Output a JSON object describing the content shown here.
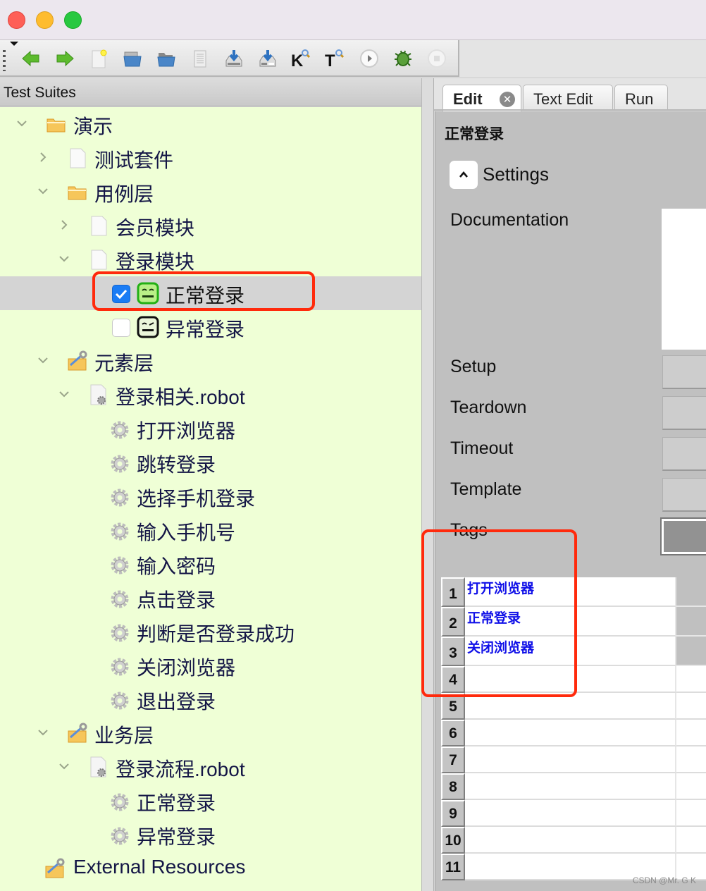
{
  "window": {
    "controls": [
      "close",
      "minimize",
      "zoom"
    ]
  },
  "toolbar": {
    "buttons": [
      {
        "name": "back-icon",
        "label": "Back"
      },
      {
        "name": "forward-icon",
        "label": "Forward"
      },
      {
        "name": "new-project-icon",
        "label": "New Project"
      },
      {
        "name": "open-test-suite-icon",
        "label": "Open Test Suite"
      },
      {
        "name": "open-directory-icon",
        "label": "Open Directory"
      },
      {
        "name": "open-resource-icon",
        "label": "Open Resource"
      },
      {
        "name": "save-icon",
        "label": "Save"
      },
      {
        "name": "save-all-icon",
        "label": "Save All"
      },
      {
        "name": "search-keywords-icon",
        "label": "K",
        "glyph": "K"
      },
      {
        "name": "search-tests-icon",
        "label": "T",
        "glyph": "T"
      },
      {
        "name": "run-icon",
        "label": "Run"
      },
      {
        "name": "debug-icon",
        "label": "Debug"
      },
      {
        "name": "stop-icon",
        "label": "Stop"
      }
    ]
  },
  "tree": {
    "header": "Test Suites",
    "nodes": [
      {
        "label": "演示",
        "level": 0,
        "icon": "folder-icon",
        "expander": "expanded"
      },
      {
        "label": "测试套件",
        "level": 1,
        "icon": "file-icon",
        "expander": "collapsed"
      },
      {
        "label": "用例层",
        "level": 1,
        "icon": "folder-icon",
        "expander": "expanded"
      },
      {
        "label": "会员模块",
        "level": 2,
        "icon": "file-icon",
        "expander": "collapsed"
      },
      {
        "label": "登录模块",
        "level": 2,
        "icon": "file-icon",
        "expander": "expanded"
      },
      {
        "label": "正常登录",
        "level": 3,
        "icon": "robot-test-icon",
        "checked": true,
        "selected": true,
        "status": "pass"
      },
      {
        "label": "异常登录",
        "level": 3,
        "icon": "robot-test-icon",
        "checked": false,
        "status": "none"
      },
      {
        "label": "元素层",
        "level": 1,
        "icon": "resource-folder-icon",
        "expander": "expanded"
      },
      {
        "label": "登录相关.robot",
        "level": 2,
        "icon": "resource-file-icon",
        "expander": "expanded"
      },
      {
        "label": "打开浏览器",
        "level": 3,
        "icon": "keyword-gear-icon"
      },
      {
        "label": "跳转登录",
        "level": 3,
        "icon": "keyword-gear-icon"
      },
      {
        "label": "选择手机登录",
        "level": 3,
        "icon": "keyword-gear-icon"
      },
      {
        "label": "输入手机号",
        "level": 3,
        "icon": "keyword-gear-icon"
      },
      {
        "label": "输入密码",
        "level": 3,
        "icon": "keyword-gear-icon"
      },
      {
        "label": "点击登录",
        "level": 3,
        "icon": "keyword-gear-icon"
      },
      {
        "label": "判断是否登录成功",
        "level": 3,
        "icon": "keyword-gear-icon"
      },
      {
        "label": "关闭浏览器",
        "level": 3,
        "icon": "keyword-gear-icon"
      },
      {
        "label": "退出登录",
        "level": 3,
        "icon": "keyword-gear-icon"
      },
      {
        "label": "业务层",
        "level": 1,
        "icon": "resource-folder-icon",
        "expander": "expanded"
      },
      {
        "label": "登录流程.robot",
        "level": 2,
        "icon": "resource-file-icon",
        "expander": "expanded"
      },
      {
        "label": "正常登录",
        "level": 3,
        "icon": "keyword-gear-icon"
      },
      {
        "label": "异常登录",
        "level": 3,
        "icon": "keyword-gear-icon"
      },
      {
        "label": "External Resources",
        "level": 0,
        "icon": "resource-folder-icon",
        "noexpander": true
      }
    ]
  },
  "tabs": [
    {
      "label": "Edit",
      "active": true,
      "closable": true
    },
    {
      "label": "Text Edit",
      "active": false
    },
    {
      "label": "Run",
      "active": false
    }
  ],
  "editor": {
    "title": "正常登录",
    "settings_label": "Settings",
    "fields": {
      "documentation": "Documentation",
      "setup": "Setup",
      "teardown": "Teardown",
      "timeout": "Timeout",
      "template": "Template",
      "tags": "Tags"
    },
    "grid_rows": [
      {
        "num": "1",
        "keyword": "打开浏览器"
      },
      {
        "num": "2",
        "keyword": "正常登录"
      },
      {
        "num": "3",
        "keyword": "关闭浏览器"
      },
      {
        "num": "4",
        "keyword": ""
      },
      {
        "num": "5",
        "keyword": ""
      },
      {
        "num": "6",
        "keyword": ""
      },
      {
        "num": "7",
        "keyword": ""
      },
      {
        "num": "8",
        "keyword": ""
      },
      {
        "num": "9",
        "keyword": ""
      },
      {
        "num": "10",
        "keyword": ""
      },
      {
        "num": "11",
        "keyword": ""
      }
    ]
  },
  "colors": {
    "tree_bg": "#efffd6",
    "keyword_link": "#1010e8",
    "annotation": "#ff2a0c",
    "checkbox": "#1a7cf5"
  },
  "watermark": "CSDN @Mr. G K"
}
